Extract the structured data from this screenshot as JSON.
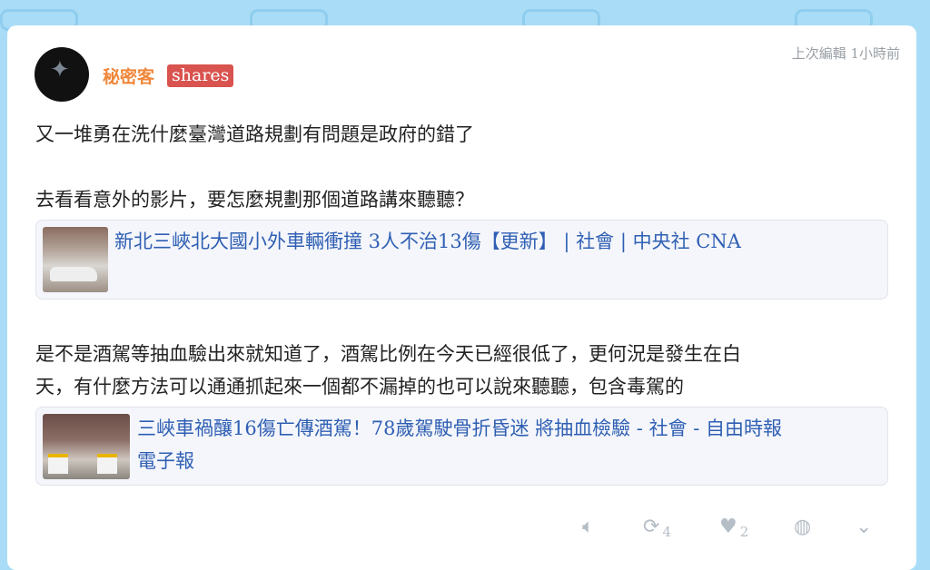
{
  "post": {
    "author": "秘密客",
    "badge": "shares",
    "edited": "上次編輯 1小時前",
    "para1": "又一堆勇在洗什麼臺灣道路規劃有問題是政府的錯了",
    "para2": "去看看意外的影片，要怎麼規劃那個道路講來聽聽？",
    "link1_title": "新北三峽北大國小外車輛衝撞 3人不治13傷【更新】 | 社會 | 中央社 CNA",
    "para3_line1": "是不是酒駕等抽血驗出來就知道了，酒駕比例在今天已經很低了，更何況是發生在白",
    "para3_line2": "天，有什麼方法可以通通抓起來一個都不漏掉的也可以說來聽聽，包含毒駕的",
    "link2_title_line1": "三峽車禍釀16傷亡傳酒駕！78歲駕駛骨折昏迷 將抽血檢驗 - 社會 - 自由時報",
    "link2_title_line2": "電子報"
  },
  "actions": {
    "boost_count": "4",
    "like_count": "2"
  },
  "icons": {
    "mute": "speaker-icon",
    "boost": "repost-icon",
    "like": "heart-icon",
    "history": "history-icon",
    "more": "chevron-down-icon"
  },
  "colors": {
    "author": "#f0873a",
    "badge": "#d9534f",
    "link": "#2f5fb3",
    "background": "#a9dcf6"
  }
}
